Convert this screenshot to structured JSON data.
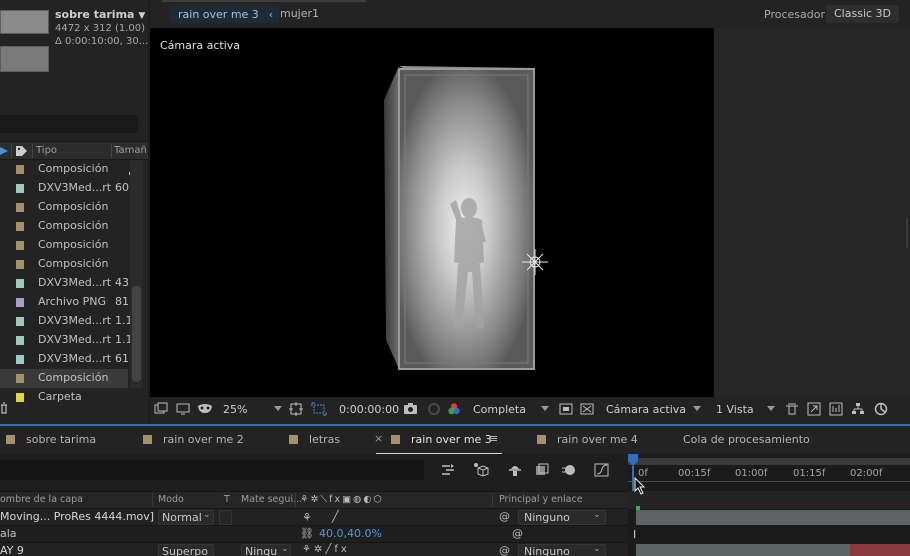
{
  "project": {
    "comp_name": "sobre tarima",
    "comp_size": "4472 x 312 (1.00)",
    "comp_duration": "Δ 0:00:10:00, 30...",
    "columns": [
      "Tipo",
      "Tamañ"
    ],
    "items": [
      {
        "type": "Composición",
        "size": "",
        "color": "#a88f6b"
      },
      {
        "type": "DXV3Med...rt",
        "size": "60",
        "color": "#9fc9c5"
      },
      {
        "type": "Composición",
        "size": "",
        "color": "#a88f6b"
      },
      {
        "type": "Composición",
        "size": "",
        "color": "#a88f6b"
      },
      {
        "type": "Composición",
        "size": "",
        "color": "#a88f6b"
      },
      {
        "type": "Composición",
        "size": "",
        "color": "#a88f6b"
      },
      {
        "type": "DXV3Med...rt",
        "size": "43",
        "color": "#9fc9c5"
      },
      {
        "type": "Archivo PNG",
        "size": "81",
        "color": "#a2a2c8"
      },
      {
        "type": "DXV3Med...rt",
        "size": "1.1",
        "color": "#9fc9c5"
      },
      {
        "type": "DXV3Med...rt",
        "size": "1.1",
        "color": "#9fc9c5"
      },
      {
        "type": "DXV3Med...rt",
        "size": "61",
        "color": "#9fc9c5"
      },
      {
        "type": "Composición",
        "size": "",
        "color": "#a88f6b"
      },
      {
        "type": "Carpeta",
        "size": "",
        "color": "#e4d440"
      }
    ]
  },
  "viewer": {
    "flow_tabs": [
      "rain over me 3",
      "mujer1"
    ],
    "processor_label": "Procesador:",
    "processor_value": "Classic 3D",
    "camera_label": "Cámara activa",
    "toolbar": {
      "zoom": "25%",
      "timecode": "0:00:00:00",
      "resolution": "Completa",
      "camera": "Cámara activa",
      "views": "1 Vista"
    }
  },
  "timeline": {
    "tabs": [
      {
        "label": "sobre tarima",
        "color": "#a88f6b"
      },
      {
        "label": "rain over me 2",
        "color": "#a88f6b"
      },
      {
        "label": "letras",
        "color": "#a88f6b"
      },
      {
        "label": "rain over me 3",
        "color": "#a88f6b"
      },
      {
        "label": "rain over me 4",
        "color": "#a88f6b"
      },
      {
        "label": "Cola de procesamiento",
        "color": ""
      }
    ],
    "columns": {
      "layer_name": "ombre de la capa",
      "mode": "Modo",
      "t": "T",
      "track_matte": "Mate segui...",
      "parent": "Principal y enlace"
    },
    "ruler": [
      "0f",
      "00:15f",
      "01:00f",
      "01:15f",
      "02:00f"
    ],
    "layers": [
      {
        "name": "Moving... ProRes 4444.mov]",
        "mode": "Normal",
        "matte": "",
        "parent": "Ninguno"
      },
      {
        "name": "ala",
        "scale": "40.0,40.0%"
      },
      {
        "name": "AY 9",
        "mode": "Superpo",
        "matte": "Ningu",
        "parent": "Ninguno"
      }
    ]
  }
}
